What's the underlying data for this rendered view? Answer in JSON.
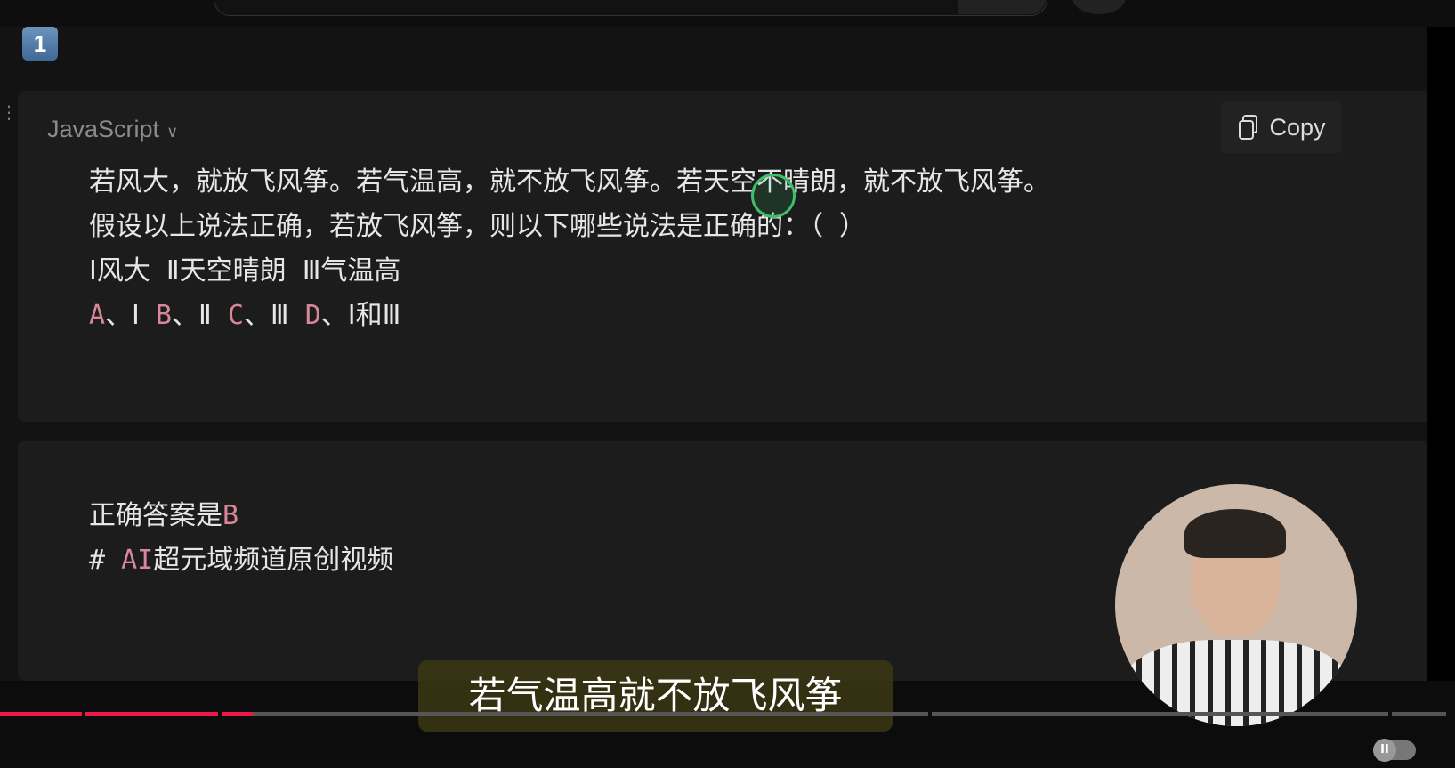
{
  "badge": "1",
  "code_block": {
    "language": "JavaScript",
    "copy_label": "Copy",
    "lines": [
      "若风大，就放飞风筝。若气温高，就不放飞风筝。若天空不晴朗，就不放飞风筝。",
      "假设以上说法正确，若放飞风筝，则以下哪些说法是正确的：（ ）",
      "Ⅰ风大 Ⅱ天空晴朗 Ⅲ气温高"
    ],
    "options": [
      {
        "letter": "A",
        "text": "、Ⅰ "
      },
      {
        "letter": "B",
        "text": "、Ⅱ "
      },
      {
        "letter": "C",
        "text": "、Ⅲ "
      },
      {
        "letter": "D",
        "text": "、Ⅰ和Ⅲ"
      }
    ]
  },
  "answer_block": {
    "answer_prefix": "正确答案是",
    "answer_letter": "B",
    "hash": "# ",
    "tag_ai": "AI",
    "tag_rest": "超元域频道原创视频"
  },
  "video": {
    "subtitle": "若气温高就不放飞风筝",
    "progress_percent": 17.5,
    "progress_color": "#f0164a",
    "pause_icon": "pause-icon"
  }
}
